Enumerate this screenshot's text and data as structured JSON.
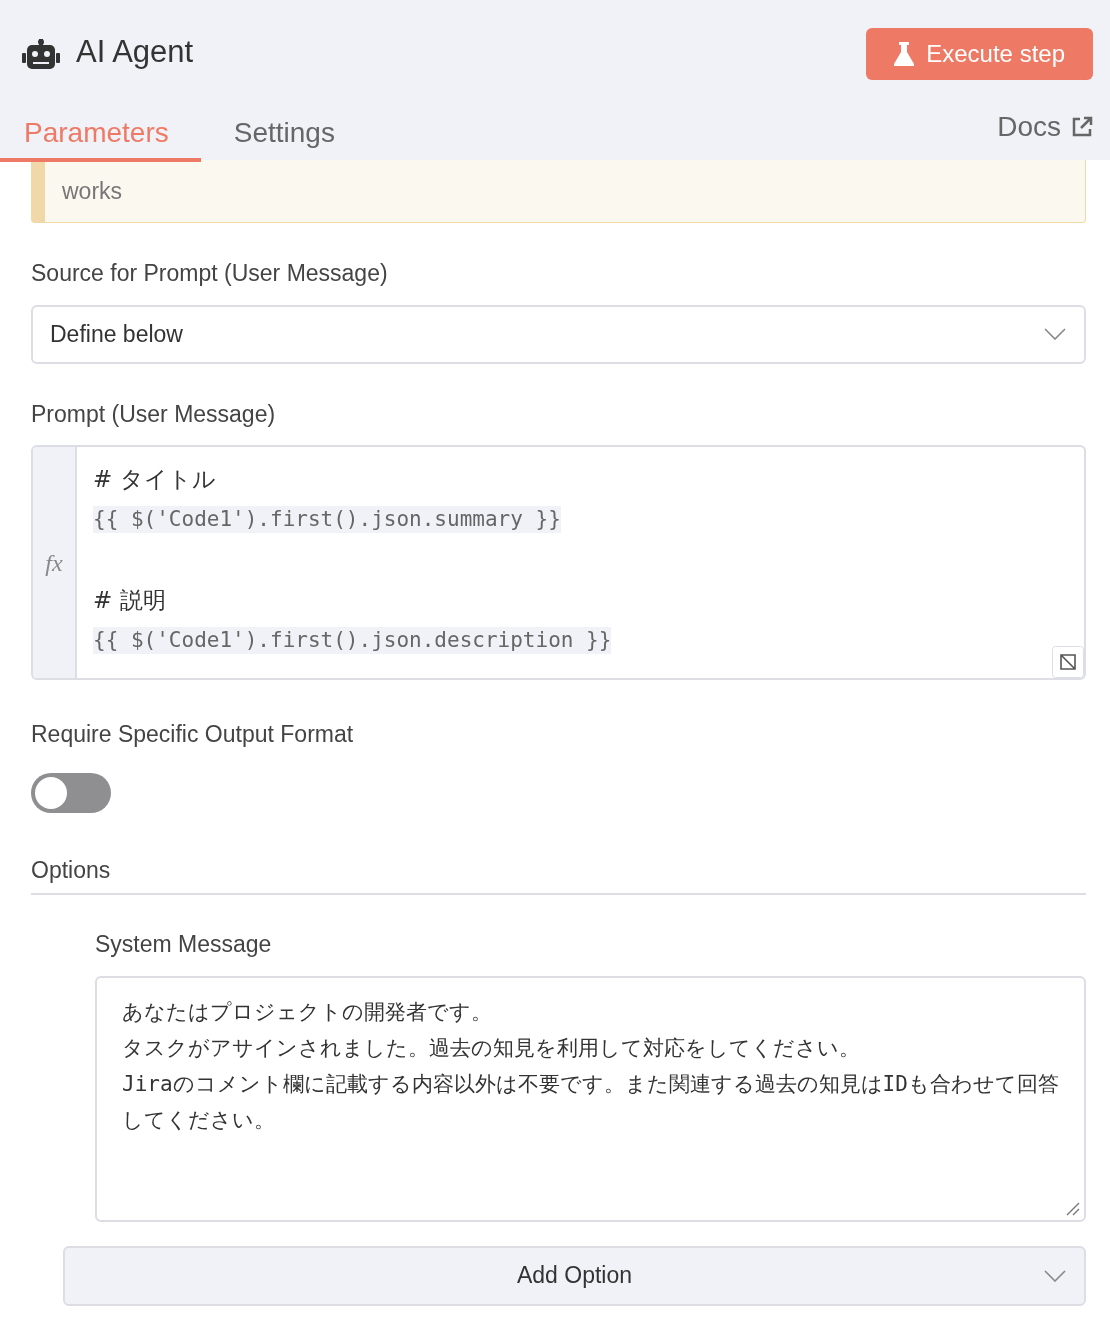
{
  "header": {
    "title": "AI Agent",
    "execute_button": "Execute step"
  },
  "tabs": [
    {
      "label": "Parameters",
      "selected": true
    },
    {
      "label": "Settings",
      "selected": false
    }
  ],
  "docs_link": "Docs",
  "tip": "works",
  "source_field": {
    "label": "Source for Prompt (User Message)",
    "value": "Define below"
  },
  "prompt_field": {
    "label": "Prompt (User Message)",
    "fx": "fx",
    "lines": [
      {
        "kind": "heading",
        "text": "# タイトル"
      },
      {
        "kind": "expression",
        "text": "{{ $('Code1').first().json.summary }}"
      },
      {
        "kind": "blank"
      },
      {
        "kind": "heading",
        "text": "# 説明"
      },
      {
        "kind": "expression",
        "text": "{{ $('Code1').first().json.description }}"
      }
    ]
  },
  "output_format": {
    "label": "Require Specific Output Format",
    "on": false
  },
  "options": {
    "title": "Options",
    "system_message": {
      "label": "System Message",
      "lines": [
        "あなたはプロジェクトの開発者です。",
        "タスクがアサインされました。過去の知見を利用して対応をしてください。",
        "Jiraのコメント欄に記載する内容以外は不要です。また関連する過去の知見はIDも合わせて回答してください。"
      ]
    },
    "add_option": "Add Option"
  }
}
